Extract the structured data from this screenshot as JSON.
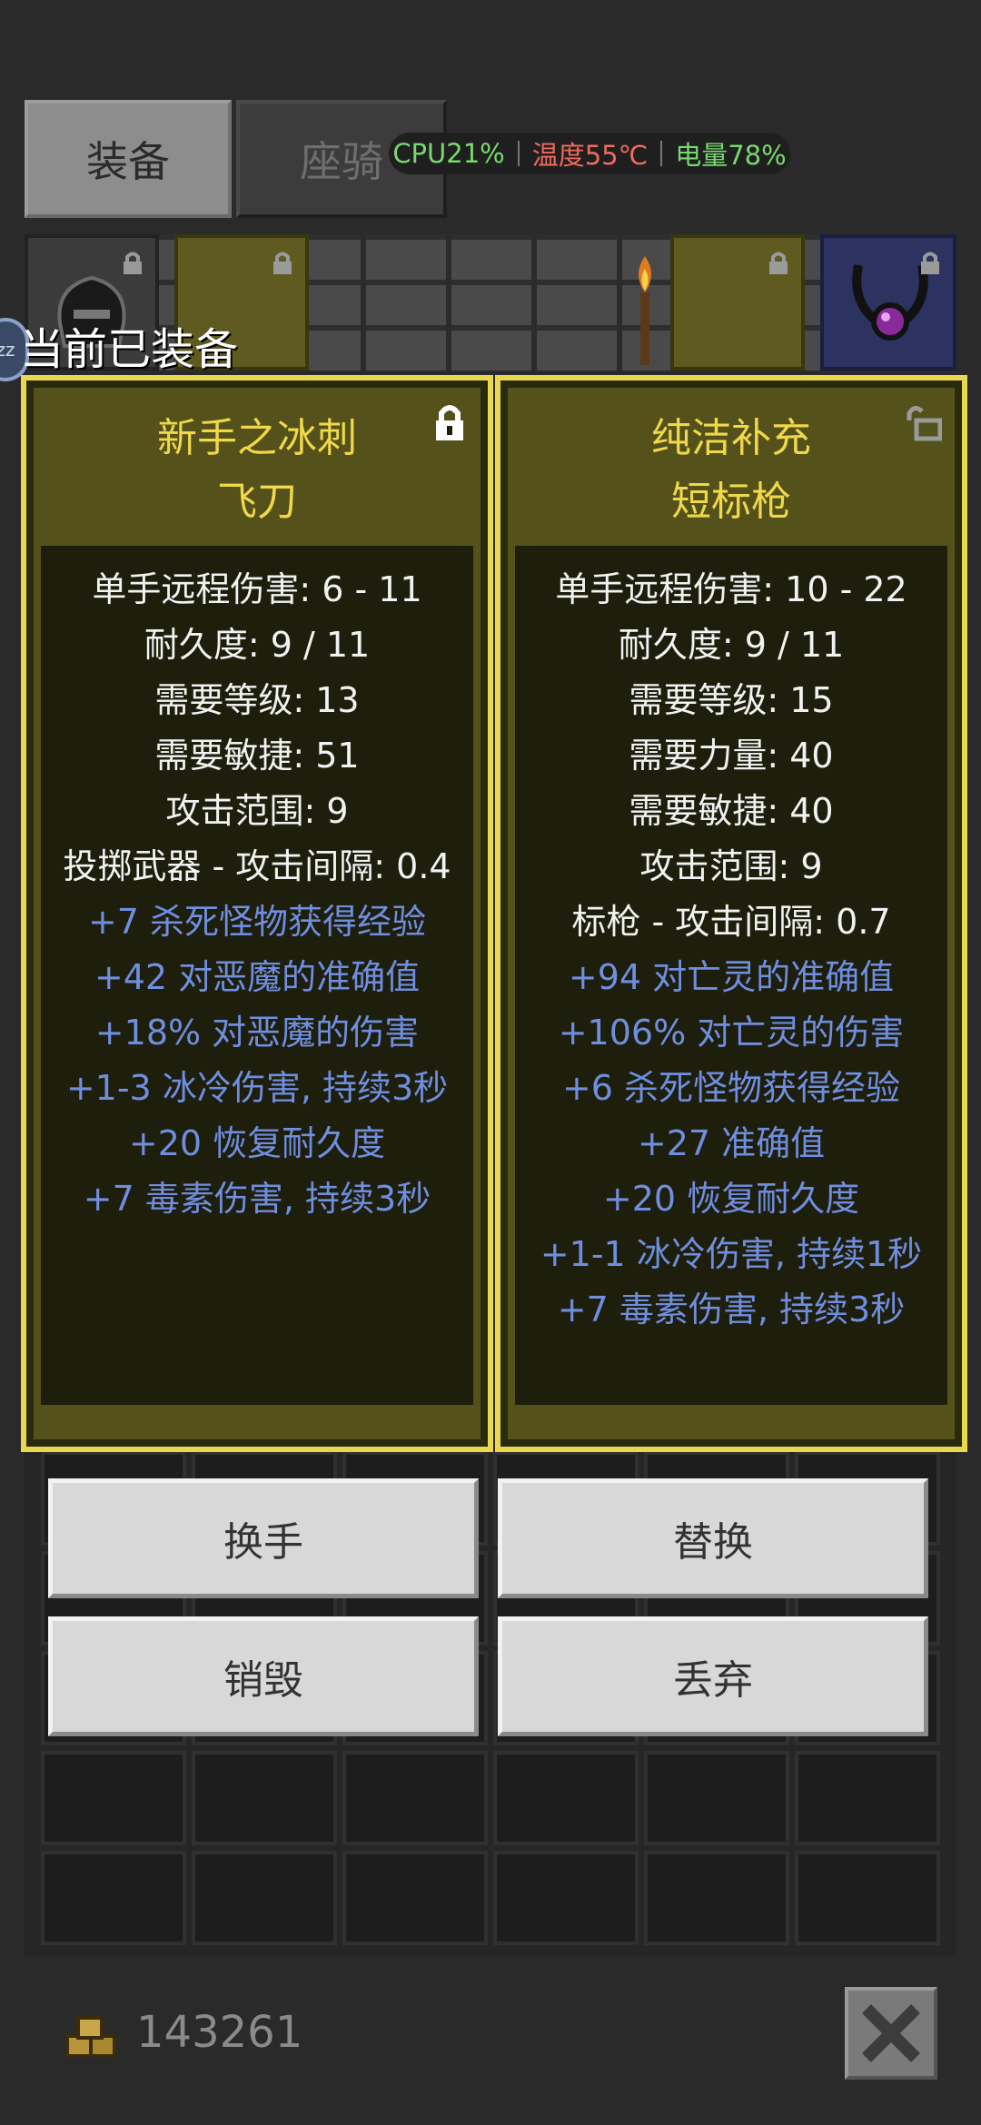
{
  "tabs": {
    "equip": "装备",
    "mount": "座骑"
  },
  "status": {
    "cpu": "CPU21%",
    "temp": "温度55℃",
    "battery": "电量78%"
  },
  "equipped_label": "当前已装备",
  "mini_badge": "zz",
  "left_card": {
    "name_line1": "新手之冰刺",
    "name_line2": "飞刀",
    "locked": true,
    "stats": [
      "单手远程伤害: 6 - 11",
      "耐久度: 9 / 11",
      "需要等级: 13",
      "需要敏捷: 51",
      "攻击范围: 9",
      "投掷武器 - 攻击间隔: 0.4"
    ],
    "affixes": [
      "+7 杀死怪物获得经验",
      "+42 对恶魔的准确值",
      "+18% 对恶魔的伤害",
      "+1-3 冰冷伤害, 持续3秒",
      "+20 恢复耐久度",
      "+7 毒素伤害, 持续3秒"
    ]
  },
  "right_card": {
    "name_line1": "纯洁补充",
    "name_line2": "短标枪",
    "locked": false,
    "stats": [
      "单手远程伤害: 10 - 22",
      "耐久度: 9 / 11",
      "需要等级: 15",
      "需要力量: 40",
      "需要敏捷: 40",
      "攻击范围: 9",
      "标枪 - 攻击间隔: 0.7"
    ],
    "affixes": [
      "+94 对亡灵的准确值",
      "+106% 对亡灵的伤害",
      "+6 杀死怪物获得经验",
      "+27 准确值",
      "+20 恢复耐久度",
      "+1-1 冰冷伤害, 持续1秒",
      "+7 毒素伤害, 持续3秒"
    ]
  },
  "actions": {
    "swap_hand": "换手",
    "replace": "替换",
    "destroy": "销毁",
    "discard": "丢弃"
  },
  "gold": "143261",
  "icons": {
    "lock": "lock-icon",
    "unlock": "unlock-icon",
    "coin": "gold-coins-icon",
    "close": "close-icon"
  },
  "colors": {
    "card_title": "#f0d84a",
    "card_border": "#e8d74f",
    "affix_blue": "#6f8ee0",
    "cpu_green": "#78d96e",
    "temp_red": "#f06a5e"
  }
}
